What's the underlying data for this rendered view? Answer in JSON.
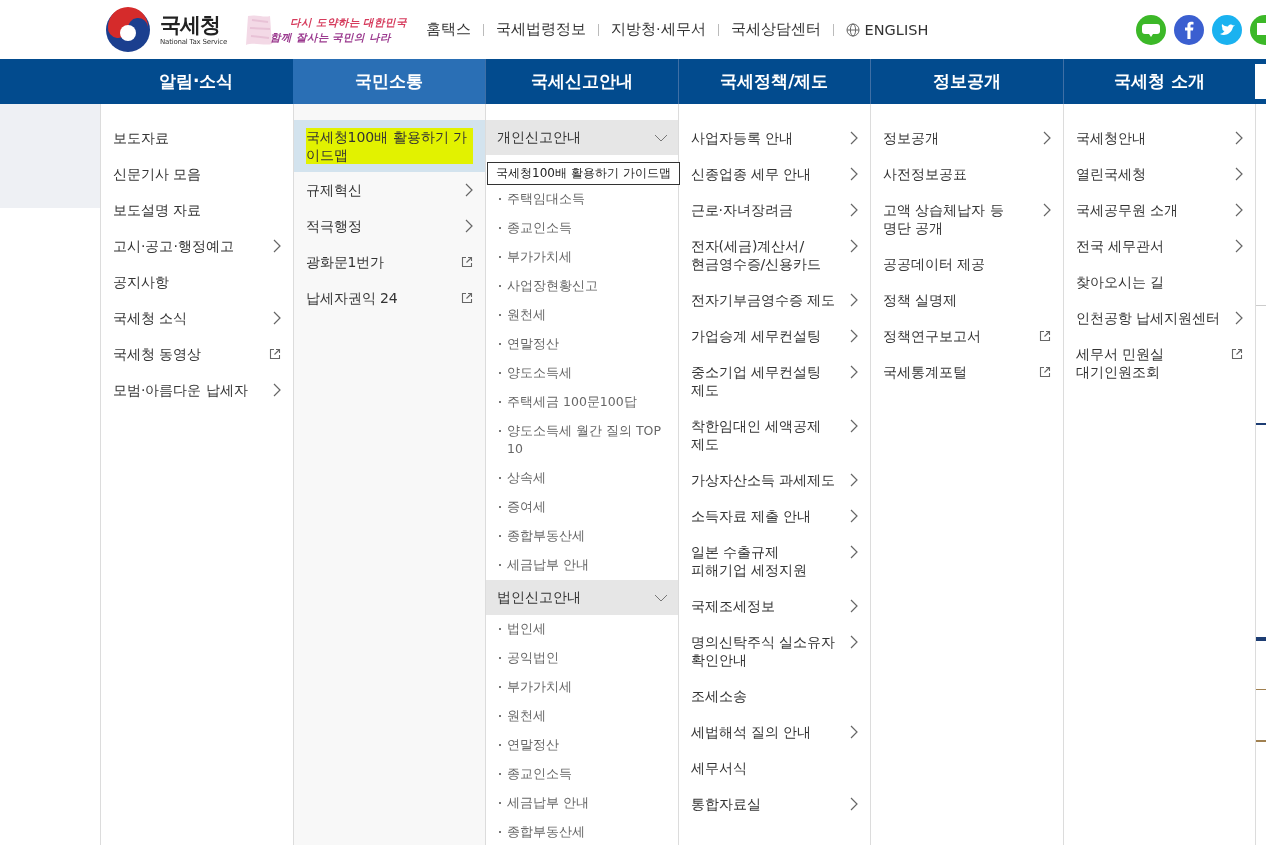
{
  "header": {
    "org_name": "국세청",
    "org_name_en": "National Tax Service",
    "slogan": [
      "다시 도약하는 대한민국",
      "함께 잘사는 국민의 나라"
    ],
    "links": [
      {
        "label": "홈택스",
        "kind": "plain"
      },
      {
        "label": "국세법령정보",
        "kind": "plain"
      },
      {
        "label": "지방청·세무서",
        "kind": "plain"
      },
      {
        "label": "국세상담센터",
        "kind": "plain"
      },
      {
        "label": "ENGLISH",
        "kind": "globe"
      }
    ],
    "social": [
      {
        "kind": "blog"
      },
      {
        "kind": "facebook"
      },
      {
        "kind": "twitter"
      },
      {
        "kind": "post"
      }
    ]
  },
  "nav": [
    {
      "label": "알림·소식",
      "selected": false
    },
    {
      "label": "국민소통",
      "selected": true
    },
    {
      "label": "국세신고안내",
      "selected": false
    },
    {
      "label": "국세정책/제도",
      "selected": false
    },
    {
      "label": "정보공개",
      "selected": false
    },
    {
      "label": "국세청 소개",
      "selected": false
    }
  ],
  "menu": [
    {
      "kind": "list",
      "items": [
        {
          "label": "보도자료",
          "kind": "plain"
        },
        {
          "label": "신문기사 모음",
          "kind": "plain"
        },
        {
          "label": "보도설명 자료",
          "kind": "plain"
        },
        {
          "label": "고시·공고·행정예고",
          "kind": "arrow"
        },
        {
          "label": "공지사항",
          "kind": "plain"
        },
        {
          "label": "국세청 소식",
          "kind": "arrow"
        },
        {
          "label": "국세청 동영상",
          "kind": "external"
        },
        {
          "label": "모범·아름다운 납세자",
          "kind": "arrow"
        }
      ]
    },
    {
      "kind": "list",
      "items": [
        {
          "label": "국세청100배 활용하기 가이드맵",
          "kind": "plain",
          "selected": true,
          "highlighted": true
        },
        {
          "label": "규제혁신",
          "kind": "arrow",
          "selected": false,
          "highlighted": false
        },
        {
          "label": "적극행정",
          "kind": "arrow",
          "selected": false,
          "highlighted": false
        },
        {
          "label": "광화문1번가",
          "kind": "external",
          "selected": false,
          "highlighted": false
        },
        {
          "label": "납세자권익 24",
          "kind": "external",
          "selected": false,
          "highlighted": false
        }
      ]
    },
    {
      "kind": "groups",
      "groups": [
        {
          "title": "개인신고안내",
          "expanded": true,
          "items": [
            "주택임대소득",
            "종교인소득",
            "부가가치세",
            "사업장현황신고",
            "원천세",
            "연말정산",
            "양도소득세",
            "주택세금 100문100답",
            "양도소득세 월간 질의 TOP 10",
            "상속세",
            "증여세",
            "종합부동산세",
            "세금납부 안내"
          ]
        },
        {
          "title": "법인신고안내",
          "expanded": true,
          "items": [
            "법인세",
            "공익법인",
            "부가가치세",
            "원천세",
            "연말정산",
            "종교인소득",
            "세금납부 안내",
            "종합부동산세"
          ]
        }
      ]
    },
    {
      "kind": "list",
      "items": [
        {
          "label": "사업자등록 안내",
          "kind": "arrow"
        },
        {
          "label": "신종업종 세무 안내",
          "kind": "arrow"
        },
        {
          "label": "근로·자녀장려금",
          "kind": "arrow"
        },
        {
          "label": "전자(세금)계산서/\n현금영수증/신용카드",
          "kind": "arrow"
        },
        {
          "label": "전자기부금영수증 제도",
          "kind": "arrow"
        },
        {
          "label": "가업승계 세무컨설팅",
          "kind": "arrow"
        },
        {
          "label": "중소기업 세무컨설팅\n제도",
          "kind": "arrow"
        },
        {
          "label": "착한임대인 세액공제\n제도",
          "kind": "arrow"
        },
        {
          "label": "가상자산소득 과세제도",
          "kind": "arrow"
        },
        {
          "label": "소득자료 제출 안내",
          "kind": "arrow"
        },
        {
          "label": "일본 수출규제\n피해기업 세정지원",
          "kind": "arrow"
        },
        {
          "label": "국제조세정보",
          "kind": "arrow"
        },
        {
          "label": "명의신탁주식 실소유자\n확인안내",
          "kind": "arrow"
        },
        {
          "label": "조세소송",
          "kind": "plain"
        },
        {
          "label": "세법해석 질의 안내",
          "kind": "arrow"
        },
        {
          "label": "세무서식",
          "kind": "plain"
        },
        {
          "label": "통합자료실",
          "kind": "arrow"
        }
      ]
    },
    {
      "kind": "list",
      "items": [
        {
          "label": "정보공개",
          "kind": "arrow"
        },
        {
          "label": "사전정보공표",
          "kind": "plain"
        },
        {
          "label": "고액 상습체납자 등\n명단 공개",
          "kind": "arrow"
        },
        {
          "label": "공공데이터 제공",
          "kind": "plain"
        },
        {
          "label": "정책 실명제",
          "kind": "plain"
        },
        {
          "label": "정책연구보고서",
          "kind": "external"
        },
        {
          "label": "국세통계포털",
          "kind": "external"
        }
      ]
    },
    {
      "kind": "list",
      "items": [
        {
          "label": "국세청안내",
          "kind": "arrow"
        },
        {
          "label": "열린국세청",
          "kind": "arrow"
        },
        {
          "label": "국세공무원 소개",
          "kind": "arrow"
        },
        {
          "label": "전국 세무관서",
          "kind": "arrow"
        },
        {
          "label": "찾아오시는 길",
          "kind": "plain"
        },
        {
          "label": "인천공항 납세지원센터",
          "kind": "arrow"
        },
        {
          "label": "세무서 민원실\n대기인원조회",
          "kind": "external"
        }
      ]
    }
  ],
  "tooltip": {
    "text": "국세청100배 활용하기 가이드맵"
  }
}
